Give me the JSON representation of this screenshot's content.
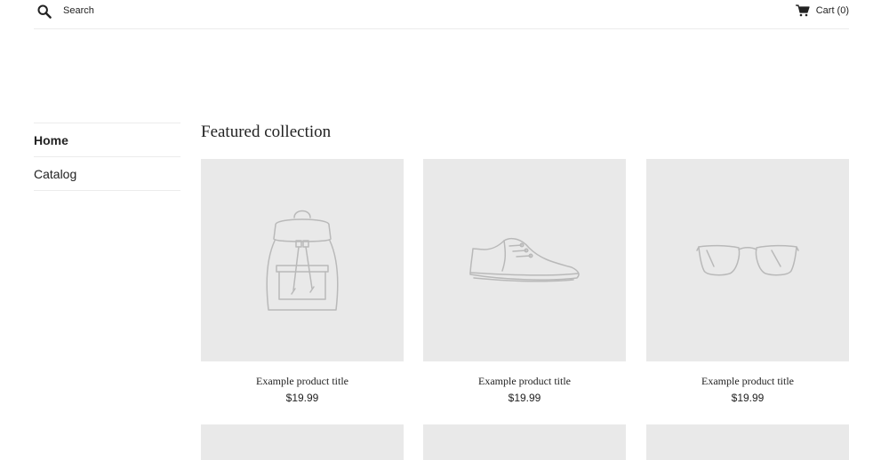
{
  "header": {
    "search_label": "Search",
    "cart_label": "Cart (0)",
    "icons": {
      "search": "search-icon",
      "cart": "cart-icon"
    }
  },
  "sidebar": {
    "items": [
      {
        "label": "Home",
        "active": true
      },
      {
        "label": "Catalog",
        "active": false
      }
    ]
  },
  "main": {
    "title": "Featured collection",
    "products": [
      {
        "image": "backpack-illustration",
        "title": "Example product title",
        "price": "$19.99"
      },
      {
        "image": "sneaker-illustration",
        "title": "Example product title",
        "price": "$19.99"
      },
      {
        "image": "glasses-illustration",
        "title": "Example product title",
        "price": "$19.99"
      }
    ]
  },
  "colors": {
    "placeholder_bg": "#e9e9e9",
    "text": "#222222",
    "divider": "#ececec"
  }
}
